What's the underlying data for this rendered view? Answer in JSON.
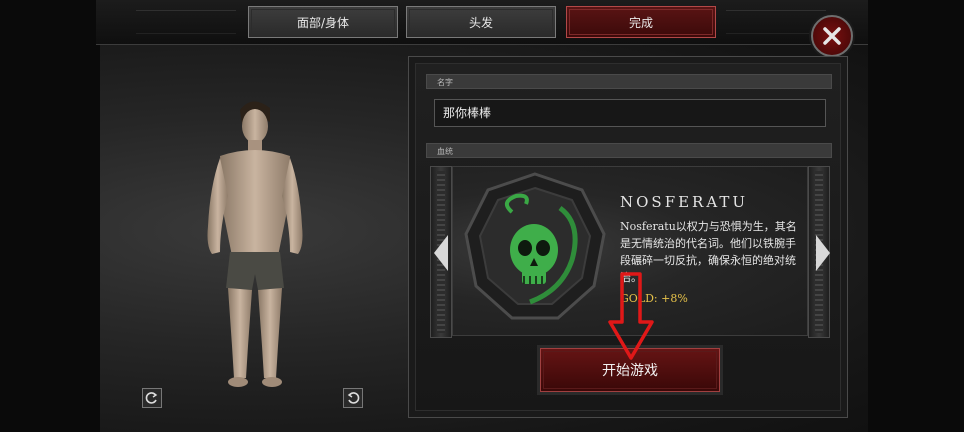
{
  "tabs": [
    {
      "label": "面部/身体",
      "active": false
    },
    {
      "label": "头发",
      "active": false
    },
    {
      "label": "完成",
      "active": true
    }
  ],
  "icons": {
    "close": "close-icon",
    "rotate_left": "rotate-left-icon",
    "rotate_right": "rotate-right-icon",
    "prev": "arrow-left-icon",
    "next": "arrow-right-icon",
    "emblem": "skull-emblem-icon",
    "annotation": "red-arrow-down-icon"
  },
  "form": {
    "name_label": "名字",
    "name_value": "那你棒棒",
    "bloodline_label": "血统"
  },
  "clan": {
    "name": "NOSFERATU",
    "description": "Nosferatu以权力与恐惧为生，其名是无情统治的代名词。他们以铁腕手段碾碎一切反抗，确保永恒的绝对统治。",
    "gold": "GOLD: +8%"
  },
  "start_button": "开始游戏",
  "colors": {
    "accent_red": "#6a1212",
    "gold_text": "#e6c24a",
    "emblem_green": "#3fae4a"
  }
}
